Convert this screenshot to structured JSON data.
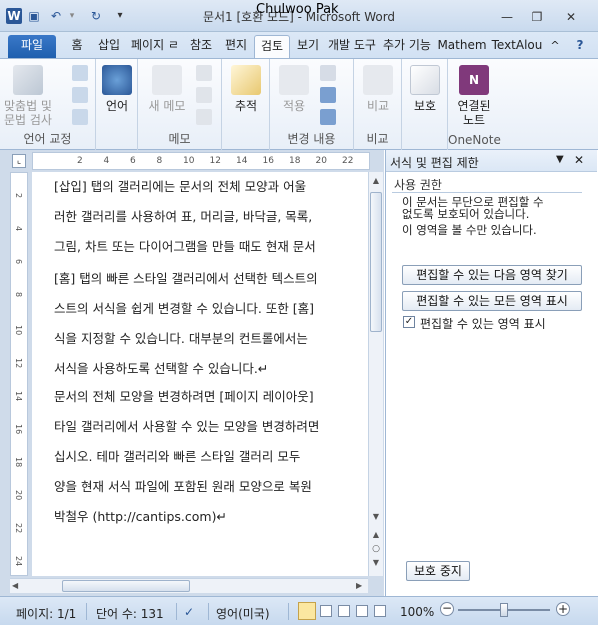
{
  "window": {
    "title": "문서1 [호환 모드] - Microsoft Word",
    "user_overlay": "Chulwoo Pak",
    "app_icon": "W",
    "controls": [
      "minimize-icon",
      "restore-icon",
      "close-icon"
    ]
  },
  "quick_access": [
    "save-icon",
    "undo-icon",
    "redo-icon",
    "customize-icon"
  ],
  "tabs": [
    "파일",
    "홈",
    "삽입",
    "페이지 ㄹ",
    "참조",
    "편지",
    "검토",
    "보기",
    "개발 도구",
    "추가 기능",
    "Mathem",
    "TextAlou"
  ],
  "active_tab": "검토",
  "ribbon": {
    "groups": [
      {
        "label": "언어 교정",
        "buttons": [
          {
            "text": "맞춤법 및\n문법 검사"
          },
          {
            "text": "언어"
          }
        ]
      },
      {
        "label": "메모",
        "buttons": [
          {
            "text": "새 메모"
          }
        ]
      },
      {
        "label": "",
        "buttons": [
          {
            "text": "추적"
          }
        ]
      },
      {
        "label": "변경 내용",
        "buttons": [
          {
            "text": "적용"
          }
        ]
      },
      {
        "label": "비교",
        "buttons": [
          {
            "text": "비교"
          }
        ]
      },
      {
        "label": "",
        "buttons": [
          {
            "text": "보호"
          }
        ]
      },
      {
        "label": "OneNote",
        "buttons": [
          {
            "text": "연결된\n노트"
          }
        ]
      }
    ]
  },
  "ruler_numbers": [
    "2",
    "4",
    "6",
    "8",
    "10",
    "12",
    "14",
    "16",
    "18",
    "20",
    "22"
  ],
  "vruler_numbers": [
    "2",
    "4",
    "6",
    "8",
    "10",
    "12",
    "14",
    "16",
    "18",
    "20",
    "22",
    "24"
  ],
  "document": {
    "paragraphs": [
      [
        "[삽입] 탭의 갤러리에는 문서의 전체 모양과 어울",
        "러한 갤러리를 사용하여 표, 머리글, 바닥글, 목록,",
        "그림, 차트 또는 다이어그램을 만들 때도 현재 문서"
      ],
      [
        "[홈] 탭의 빠른 스타일 갤러리에서 선택한 텍스트의",
        "스트의 서식을 쉽게 변경할 수 있습니다. 또한 [홈]",
        "식을 지정할 수 있습니다. 대부분의 컨트롤에서는",
        "서식을 사용하도록 선택할 수 있습니다.↵"
      ],
      [
        "문서의 전체 모양을 변경하려면 [페이지 레이아웃]",
        "타일 갤러리에서 사용할 수 있는 모양을 변경하려면",
        "십시오. 테마 갤러리와 빠른 스타일 갤러리 모두",
        "양을 현재 서식 파일에 포함된 원래 모양으로 복원"
      ],
      [
        "박철우 (http://cantips.com)↵"
      ]
    ]
  },
  "pane": {
    "title": "서식 및 편집 제한",
    "section": "사용 권한",
    "message_line1": "이 문서는 무단으로 편집할 수",
    "message_line2": "없도록 보호되어 있습니다.",
    "message_line3": "이 영역을 볼 수만 있습니다.",
    "button_next": "편집할 수 있는 다음 영역 찾기",
    "button_all": "편집할 수 있는 모든 영역 표시",
    "checkbox_label": "편집할 수 있는 영역 표시",
    "checkbox_checked": true,
    "stop_button": "보호 중지"
  },
  "status": {
    "page": "페이지: 1/1",
    "words": "단어 수: 131",
    "language": "영어(미국)",
    "zoom": "100%"
  }
}
